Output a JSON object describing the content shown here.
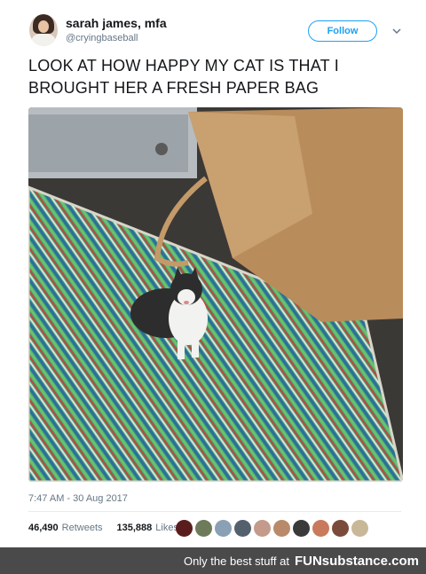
{
  "user": {
    "name": "sarah james, mfa",
    "handle": "@cryingbaseball"
  },
  "follow_label": "Follow",
  "tweet_text": "LOOK AT HOW HAPPY MY CAT IS THAT I BROUGHT HER A FRESH PAPER BAG",
  "timestamp": "7:47 AM - 30 Aug 2017",
  "retweets": {
    "count": "46,490",
    "label": "Retweets"
  },
  "likes": {
    "count": "135,888",
    "label": "Likes"
  },
  "footer": {
    "text": "Only the best stuff at",
    "brand": "FUNsubstance.com"
  },
  "colors": {
    "accent": "#1da1f2",
    "muted": "#657786",
    "footer_bg": "#4a4a4a"
  },
  "icons": {
    "more": "chevron-down-icon"
  }
}
